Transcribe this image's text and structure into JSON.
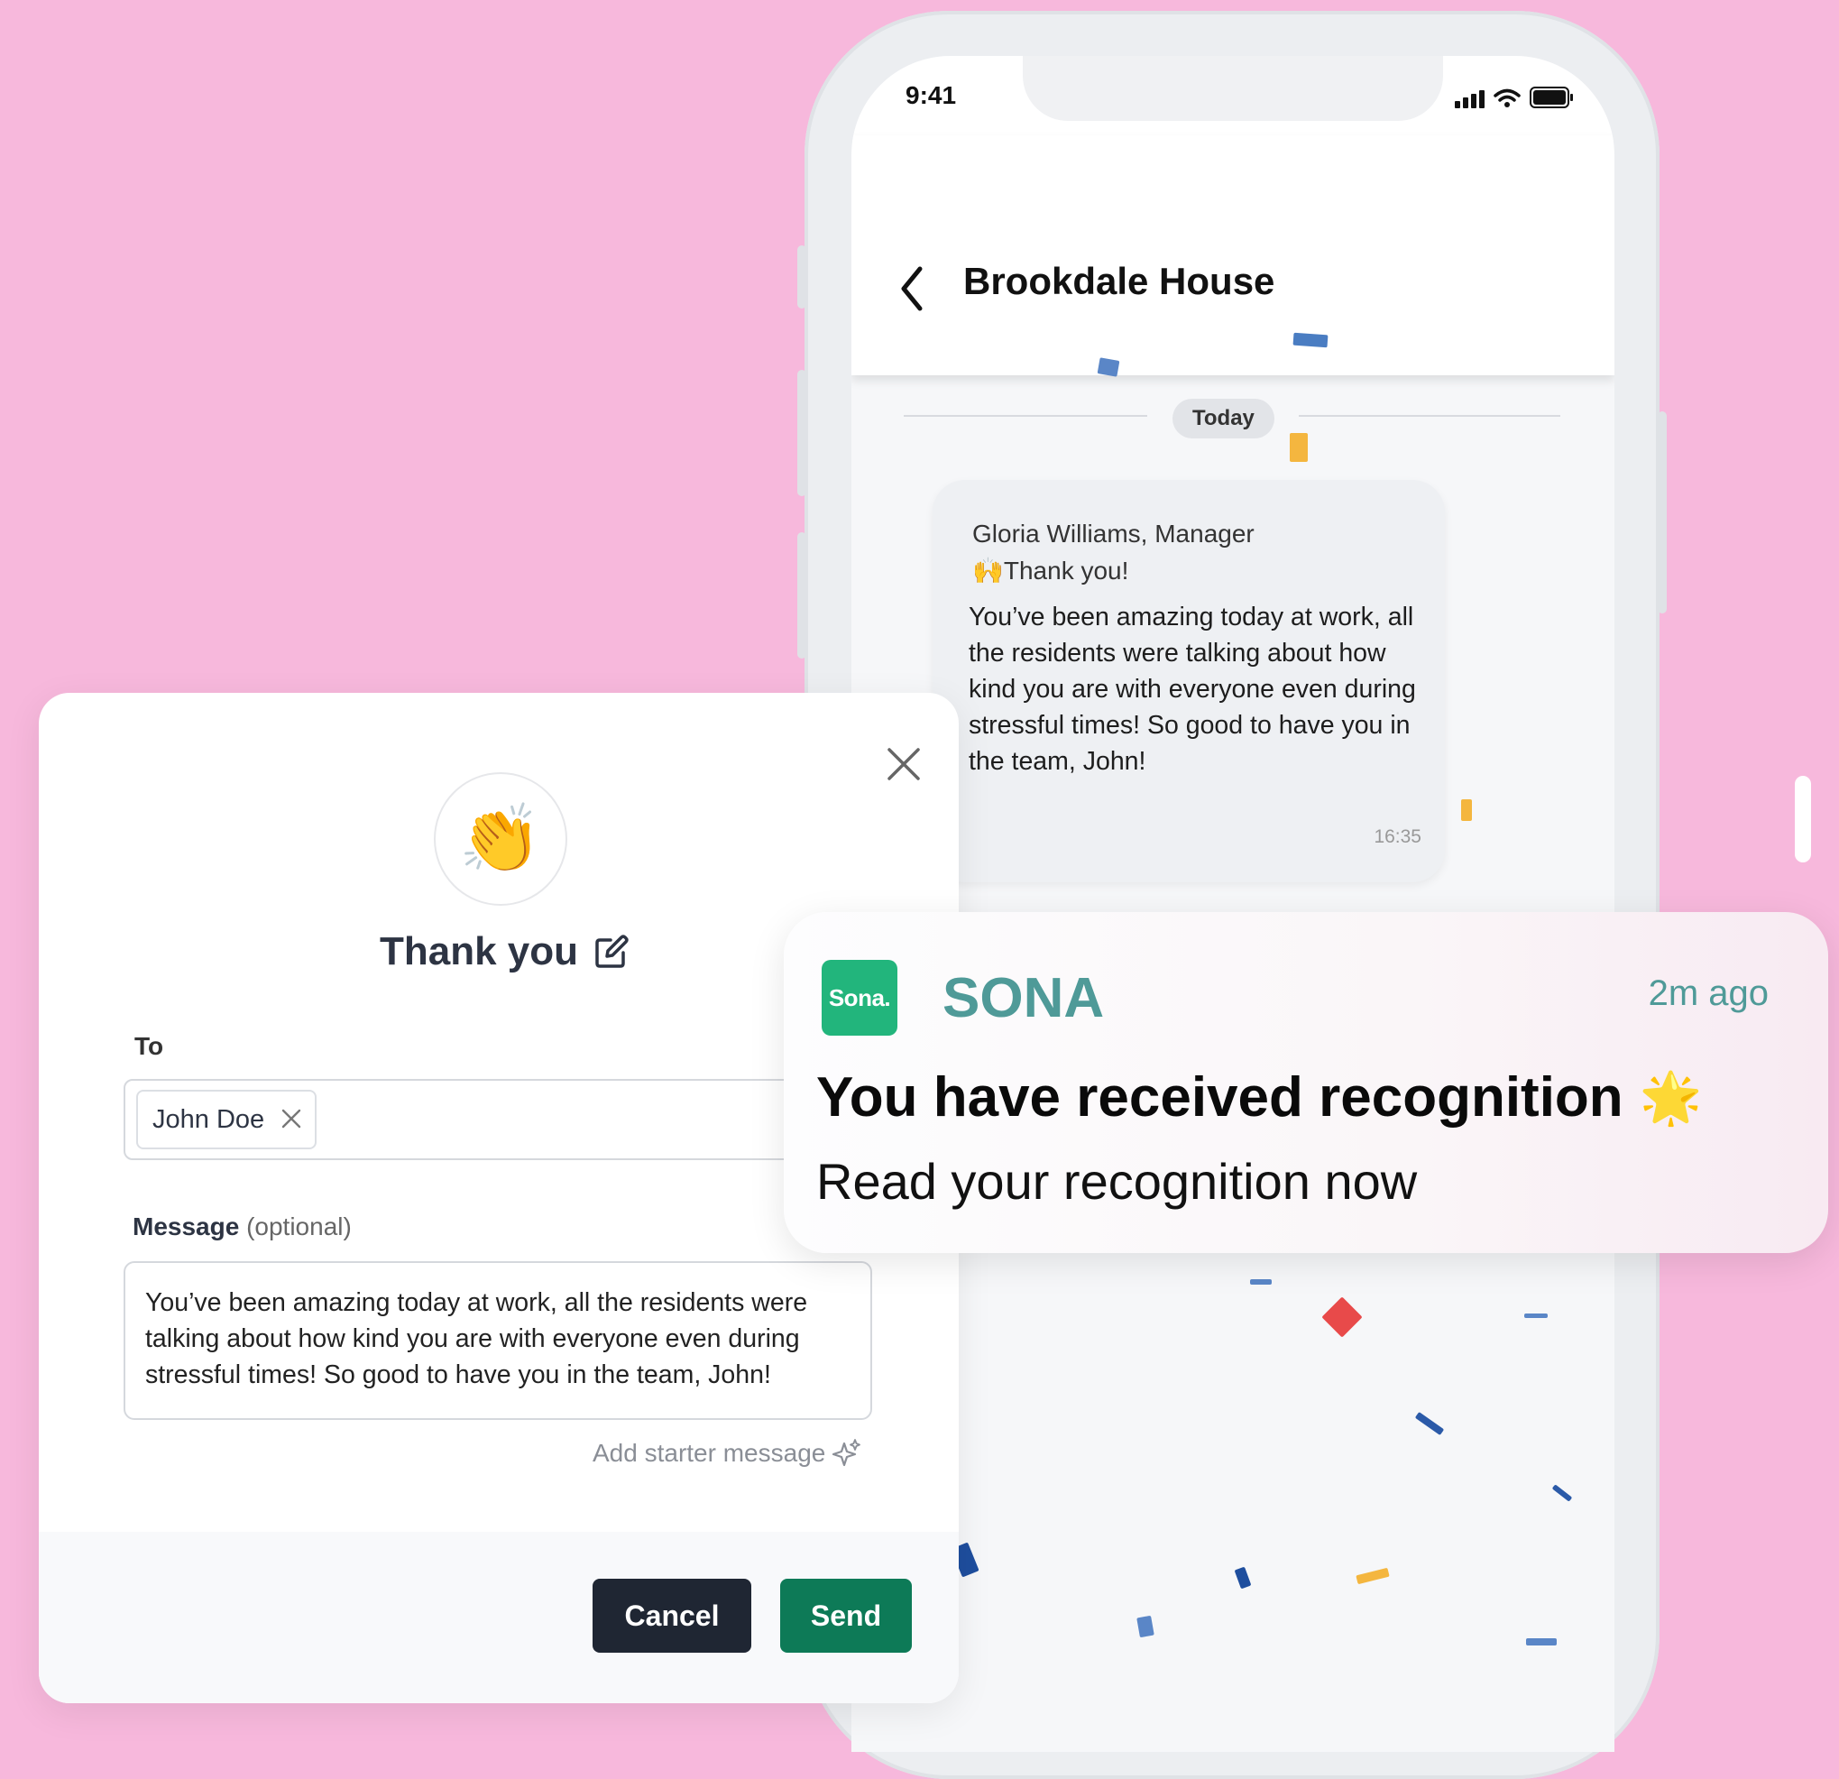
{
  "status_bar": {
    "time": "9:41"
  },
  "chat": {
    "title": "Brookdale House",
    "date_separator": "Today",
    "message": {
      "sender": "Gloria Williams, Manager",
      "emoji": "🙌",
      "subject": "Thank you!",
      "body": "You’ve been amazing today at work, all the residents were talking about how kind you are with everyone even during stressful times! So good to have you in the team, John!",
      "time": "16:35"
    }
  },
  "modal": {
    "emoji": "👏",
    "title": "Thank you",
    "to_label": "To",
    "recipient": "John Doe",
    "message_label": "Message",
    "message_optional": "(optional)",
    "message_value": "You’ve been amazing today at work, all the residents were talking about how kind you are with everyone even during stressful times! So good to have you in the team, John!",
    "starter_label": "Add starter message",
    "cancel_label": "Cancel",
    "send_label": "Send"
  },
  "notification": {
    "app_logo_text": "Sona.",
    "app_name": "SONA",
    "time": "2m ago",
    "title": "You have received recognition",
    "title_emoji": "🌟",
    "body": "Read your recognition now"
  },
  "colors": {
    "background": "#f7b8dc",
    "brand_green": "#22b57c",
    "send_button": "#0d7a57",
    "cancel_button": "#1f2633",
    "app_name": "#4f9a98"
  }
}
